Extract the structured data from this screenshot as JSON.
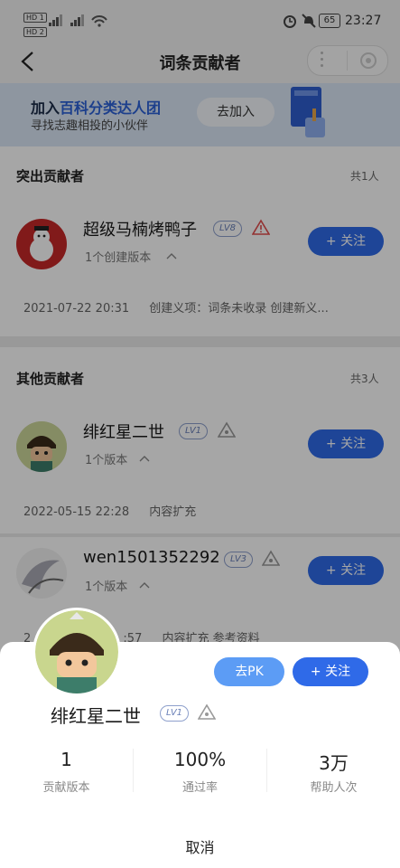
{
  "status_bar": {
    "time": "23:27",
    "battery": "65",
    "sim1": "HD 1",
    "sim2": "HD 2"
  },
  "nav": {
    "title": "词条贡献者"
  },
  "banner": {
    "join": "加入",
    "group": "百科分类达人团",
    "subtitle": "寻找志趣相投的小伙伴",
    "button": "去加入"
  },
  "outstanding": {
    "title": "突出贡献者",
    "count": "共1人",
    "user": {
      "name": "超级马楠烤鸭子",
      "level": "LV8",
      "versions": "1个创建版本",
      "follow": "+ 关注",
      "log_time": "2021-07-22 20:31",
      "log_text": "创建义项：词条未收录 创建新义..."
    }
  },
  "others": {
    "title": "其他贡献者",
    "count": "共3人",
    "users": [
      {
        "name": "绯红星二世",
        "level": "LV1",
        "versions": "1个版本",
        "follow": "+ 关注",
        "log_time": "2022-05-15 22:28",
        "log_text": "内容扩充"
      },
      {
        "name": "wen1501352292",
        "level": "LV3",
        "versions": "1个版本",
        "follow": "+ 关注",
        "log_time": "2",
        "log_time_tail": ":57",
        "log_text": "内容扩充 参考资料"
      }
    ]
  },
  "sheet": {
    "name": "绯红星二世",
    "level": "LV1",
    "pk": "去PK",
    "follow": "+ 关注",
    "stats": [
      {
        "value": "1",
        "label": "贡献版本"
      },
      {
        "value": "100%",
        "label": "通过率"
      },
      {
        "value": "3万",
        "label": "帮助人次"
      }
    ],
    "cancel": "取消"
  }
}
